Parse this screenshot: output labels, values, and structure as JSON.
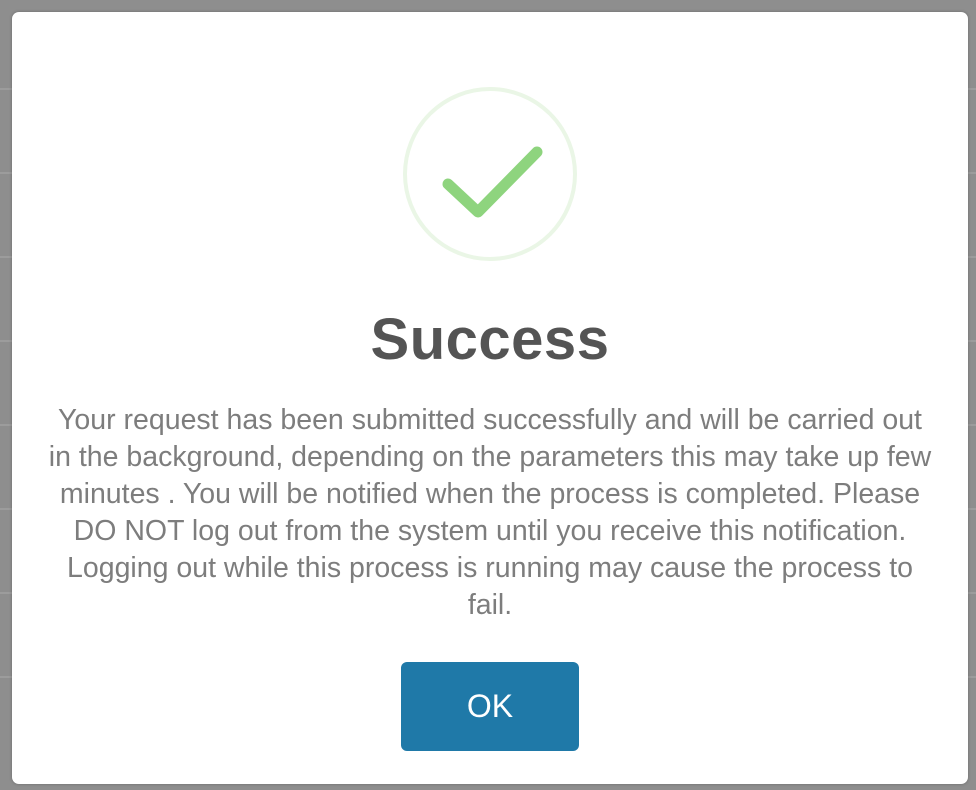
{
  "dialog": {
    "title": "Success",
    "message": "Your request has been submitted successfully and will be carried out in the background, depending on the parameters this may take up few minutes . You will be notified when the process is completed. Please DO NOT log out from the system until you receive this notification. Logging out while this process is running may cause the process to fail.",
    "ok_label": "OK",
    "icon": "success-checkmark-icon"
  },
  "colors": {
    "checkmark": "#8ed47e",
    "ring": "#eaf6e6",
    "button": "#1f79a8",
    "title": "#545454",
    "message": "#7d7d7d"
  }
}
